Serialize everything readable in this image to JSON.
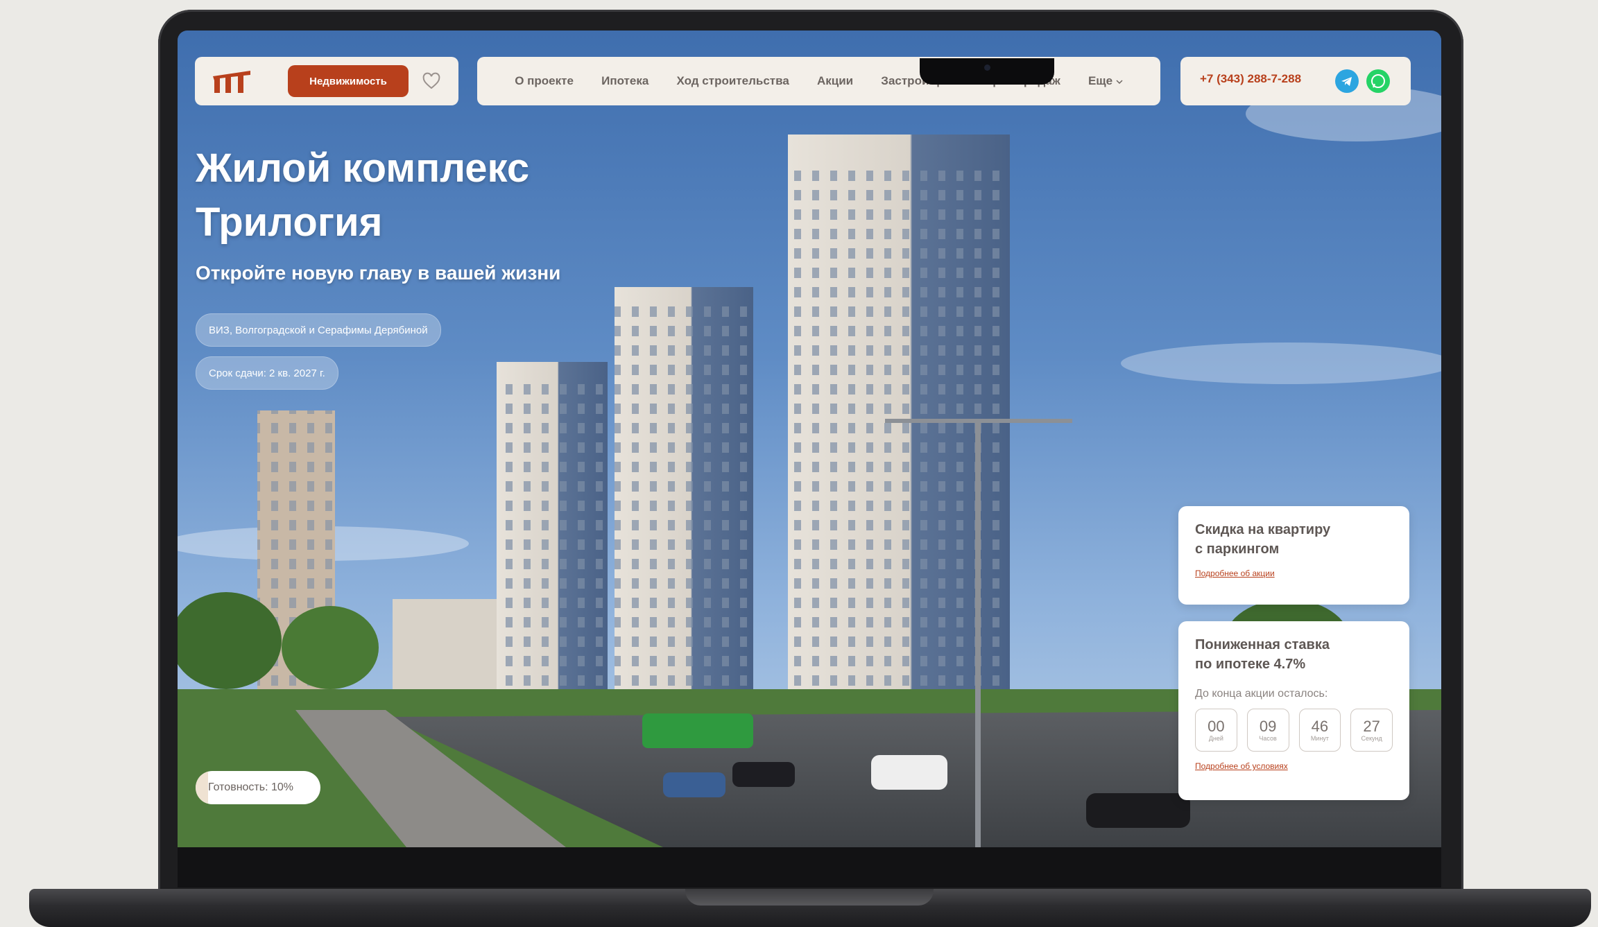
{
  "header": {
    "realty_button": "Недвижимость",
    "nav": [
      "О проекте",
      "Ипотека",
      "Ход строительства",
      "Акции",
      "Застройщик",
      "Офис продаж",
      "Еще"
    ],
    "phone": "+7 (343) 288-7-288"
  },
  "hero": {
    "title_line1": "Жилой комплекс",
    "title_line2": "Трилогия",
    "subtitle": "Откройте новую главу в вашей жизни",
    "address": "ВИЗ, Волгоградской и Серафимы Дерябиной",
    "deadline": "Срок сдачи: 2 кв. 2027 г.",
    "readiness": "Готовность: 10%",
    "readiness_value": 0.1
  },
  "promos": {
    "parking": {
      "title_line1": "Скидка на квартиру",
      "title_line2": "с паркингом",
      "link": "Подробнее об акции"
    },
    "mortgage": {
      "title_line1": "Пониженная ставка",
      "title_line2": "по ипотеке 4.7%",
      "countdown_label": "До конца акции осталось:",
      "countdown": [
        {
          "value": "00",
          "unit": "Дней"
        },
        {
          "value": "09",
          "unit": "Часов"
        },
        {
          "value": "46",
          "unit": "Минут"
        },
        {
          "value": "27",
          "unit": "Секунд"
        }
      ],
      "link": "Подробнее об условиях"
    }
  },
  "colors": {
    "accent": "#b8401c",
    "bar_bg": "#f3efe9",
    "telegram": "#2ca5e0",
    "whatsapp": "#25d366"
  },
  "icons": [
    "logo-icon",
    "heart-icon",
    "chevron-down-icon",
    "telegram-icon",
    "whatsapp-icon"
  ]
}
